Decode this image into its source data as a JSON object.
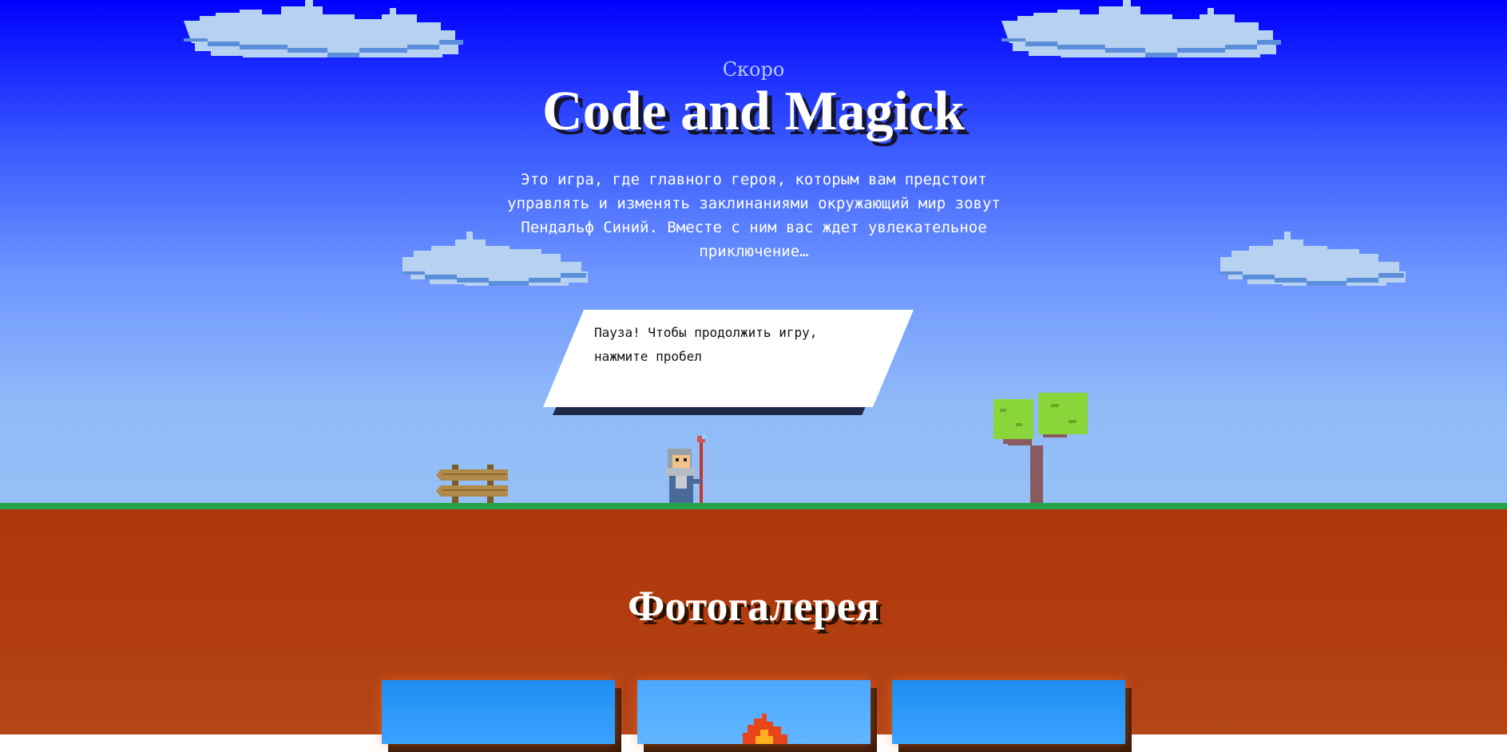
{
  "hero": {
    "subtitle": "Скоро",
    "title": "Code and Magick",
    "intro": "Это игра, где главного героя, которым вам предстоит управлять и изменять заклинаниями окружающий мир зовут Пендальф Синий. Вместе с ним вас ждет увлекательное приключение…"
  },
  "game": {
    "pause_line1": "Пауза! Чтобы продолжить игру,",
    "pause_line2": "нажмите пробел"
  },
  "gallery": {
    "title": "Фотогалерея",
    "photo_count": 3
  },
  "colors": {
    "sky_top": "#0000ff",
    "sky_bottom": "#96c0f6",
    "grass": "#27a34c",
    "ground": "#b0360b",
    "cloud": "#b7d2f0",
    "dialog_shadow": "#1f2a48"
  },
  "icons": [
    "cloud-icon",
    "wizard-icon",
    "signpost-icon",
    "tree-icon",
    "fireball-icon"
  ]
}
